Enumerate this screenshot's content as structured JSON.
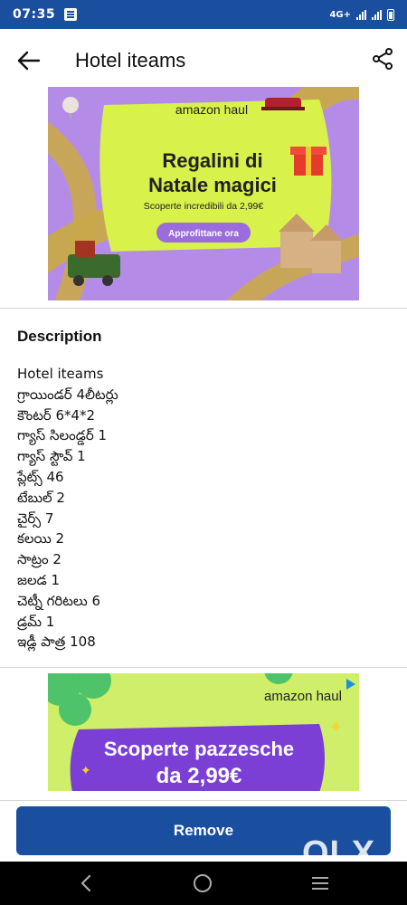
{
  "status_bar": {
    "time": "07:35",
    "network": "4G+"
  },
  "app_bar": {
    "title": "Hotel iteams",
    "back_icon": "arrow-left-icon",
    "share_icon": "share-icon"
  },
  "ad_top": {
    "brand": "amazon haul",
    "headline_line1": "Regalini di",
    "headline_line2": "Natale magici",
    "subline": "Scoperte incredibili da 2,99€",
    "cta": "Approfittane ora",
    "colors": {
      "background": "#b48ce8",
      "card": "#d8f14b",
      "cta": "#9b6ddc",
      "stripe": "#c9a94a"
    }
  },
  "description": {
    "heading": "Description",
    "lines": [
      "Hotel iteams",
      "గ్రాయిండర్ 4లీటర్లు",
      "కౌంటర్ 6*4*2",
      "గ్యాస్ సిలండ్డర్ 1",
      "గ్యాస్ స్టౌవ్ 1",
      "ప్లేట్స్ 46",
      "టేబుల్ 2",
      "చైర్స్ 7",
      "కలయి 2",
      "సాట్రం 2",
      "జలడ  1",
      "చెట్నీ గరిటలు 6",
      "డ్రమ్ 1",
      "ఇడ్లీ పాత్ర 108"
    ]
  },
  "ad_bottom": {
    "brand": "amazon haul",
    "headline_line1": "Scoperte pazzesche",
    "headline_line2": "da 2,99€",
    "colors": {
      "background": "#cfee6a",
      "banner": "#7b3fd6",
      "clover": "#4fc36a"
    }
  },
  "action": {
    "remove_label": "Remove",
    "color": "#1a4fa0"
  },
  "watermark": "OLX"
}
